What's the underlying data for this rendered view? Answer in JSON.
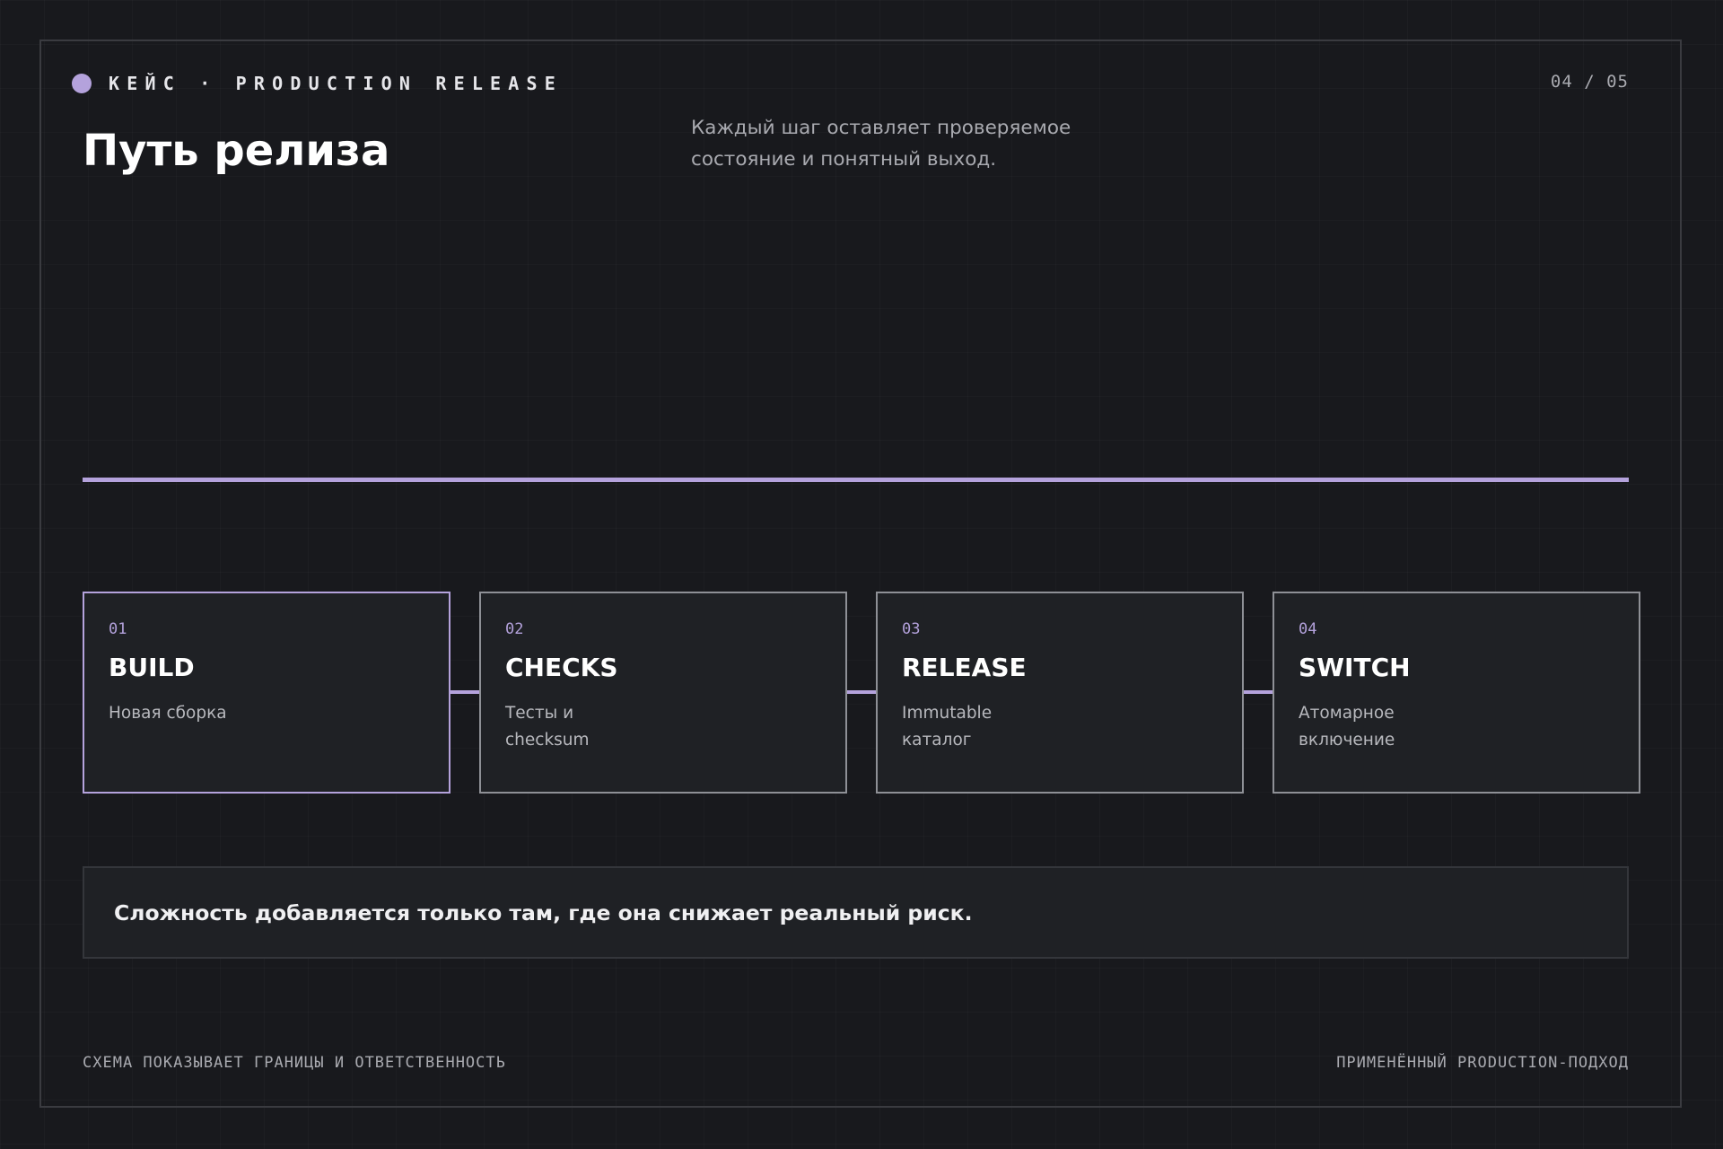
{
  "header": {
    "kicker": "КЕЙС · PRODUCTION RELEASE",
    "page_counter": "04 / 05",
    "title": "Путь релиза",
    "subtitle": "Каждый шаг оставляет проверяемое состояние и понятный выход."
  },
  "steps": [
    {
      "number": "01",
      "title": "BUILD",
      "description": "Новая сборка",
      "highlighted": true
    },
    {
      "number": "02",
      "title": "CHECKS",
      "description": "Тесты и checksum",
      "highlighted": false
    },
    {
      "number": "03",
      "title": "RELEASE",
      "description": "Immutable каталог",
      "highlighted": false
    },
    {
      "number": "04",
      "title": "SWITCH",
      "description": "Атомарное включение",
      "highlighted": false
    }
  ],
  "callout": {
    "text": "Сложность добавляется только там, где она снижает реальный риск."
  },
  "footer": {
    "left": "СХЕМА ПОКАЗЫВАЕТ ГРАНИЦЫ И ОТВЕТСТВЕННОСТЬ",
    "right": "ПРИМЕНЁННЫЙ PRODUCTION-ПОДХОД"
  },
  "colors": {
    "background": "#18191d",
    "accent": "#b4a2dc",
    "card_background": "#1f2125",
    "card_border": "#8e9096",
    "muted_text": "#a9aab0"
  }
}
